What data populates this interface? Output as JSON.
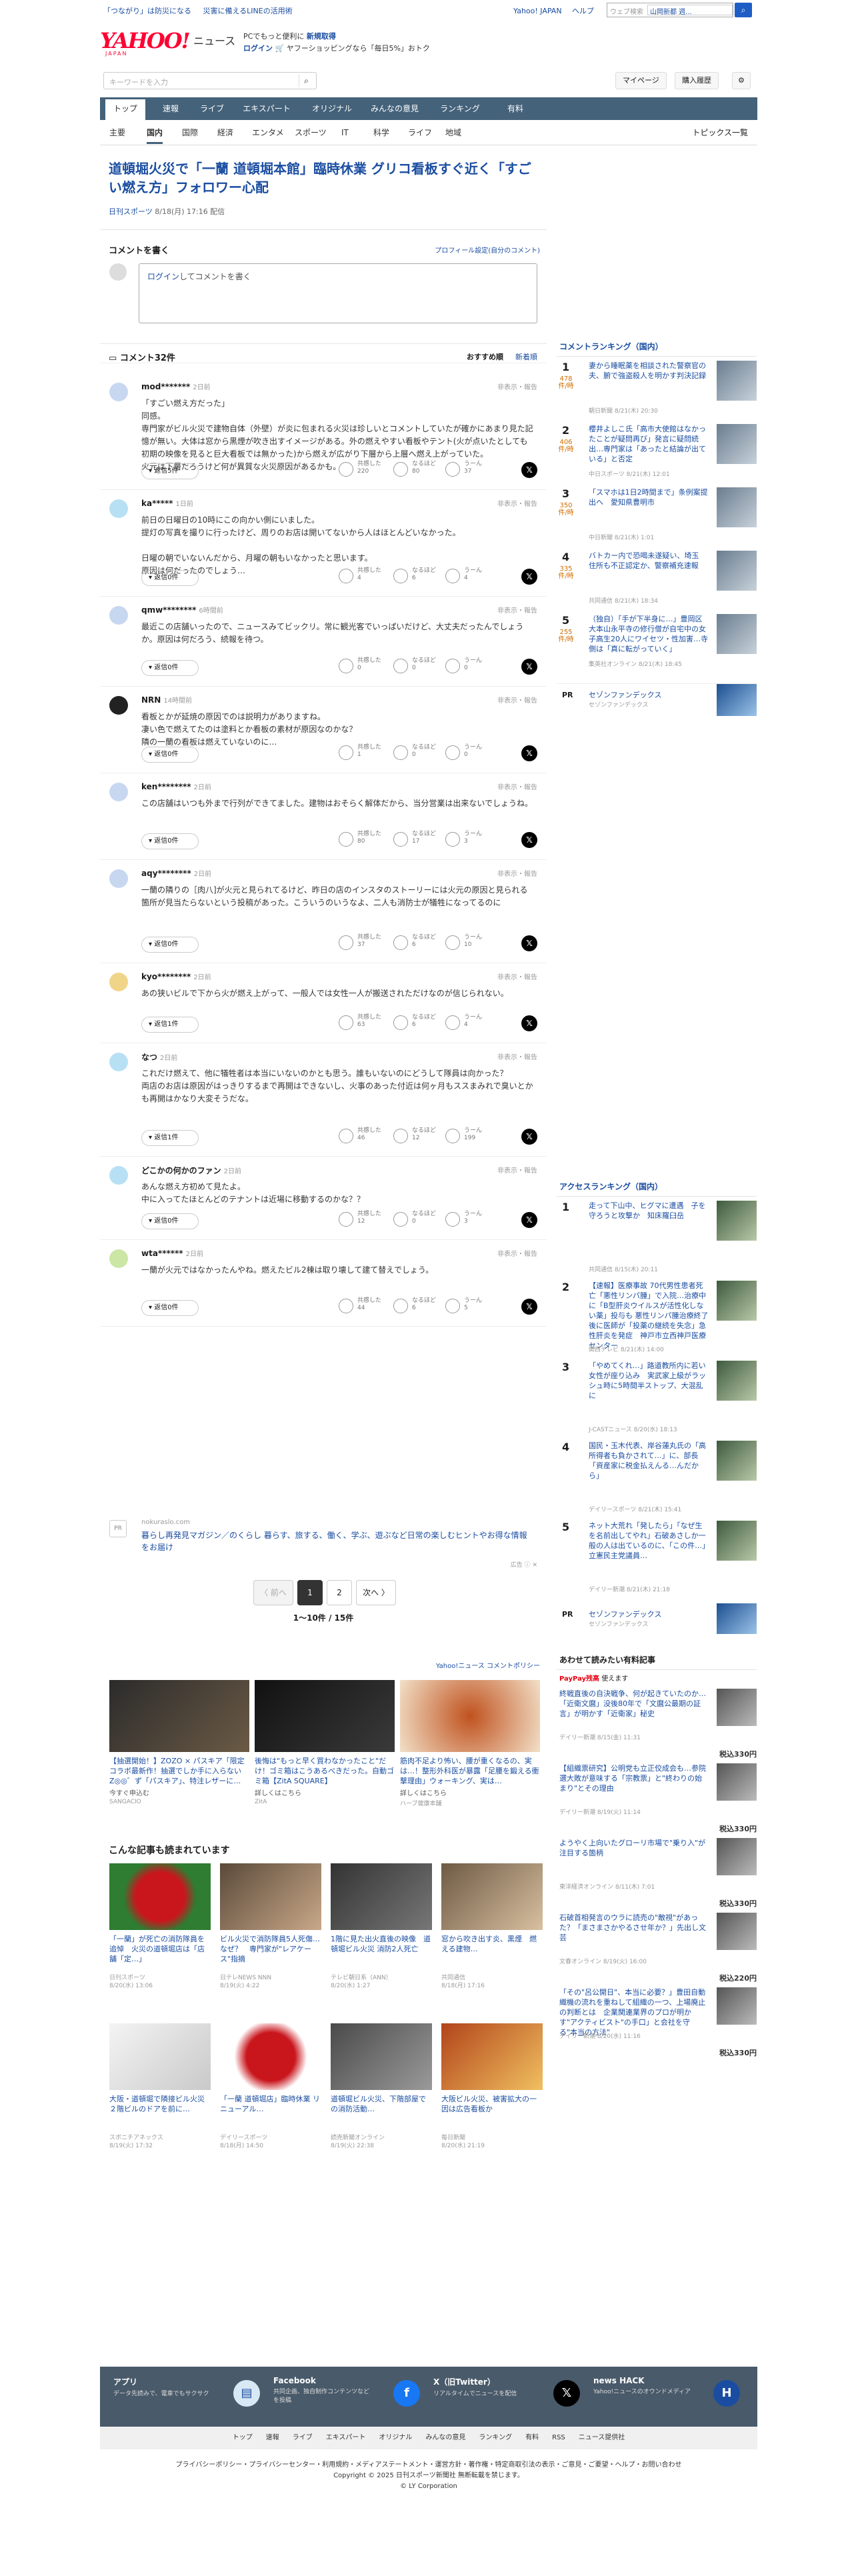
{
  "topstrip": {
    "links_left": [
      "「つながり」は防災になる",
      "災害に備えるLINEの活用術"
    ],
    "links_right": [
      "Yahoo! JAPAN",
      "ヘルプ"
    ],
    "search_placeholder": "ウェブ検索",
    "search_select": "山岡新都 週..."
  },
  "header": {
    "logo_text": "YAHOO!",
    "logo_sub": "JAPAN",
    "brand": "ニュース",
    "promo_line1": "PCでもっと便利に",
    "promo_line1_link": "新規取得",
    "promo_line2_link": "ログイン",
    "promo_line2": "🛒 ヤフーショッピングなら「毎日5%」おトク"
  },
  "search": {
    "placeholder": "キーワードを入力",
    "mypage": "マイページ",
    "history": "購入履歴"
  },
  "nav": {
    "primary": [
      "トップ",
      "速報",
      "ライブ",
      "エキスパート",
      "オリジナル",
      "みんなの意見",
      "ランキング",
      "有料"
    ],
    "primary_active": 0,
    "secondary": [
      "主要",
      "国内",
      "国際",
      "経済",
      "エンタメ",
      "スポーツ",
      "IT",
      "科学",
      "ライフ",
      "地域"
    ],
    "secondary_active": 1,
    "topics": "トピックス一覧"
  },
  "article": {
    "title": "道頓堀火災で「一蘭 道頓堀本館」臨時休業 グリコ看板すぐ近く「すごい燃え方」フォロワー心配",
    "source": "日刊スポーツ",
    "date": "8/18(月) 17:16 配信"
  },
  "comment_form": {
    "heading": "コメントを書く",
    "profile_link": "プロフィール設定(自分のコメント)",
    "login": "ログイン",
    "placeholder": "してコメントを書く"
  },
  "comment_list": {
    "count": "コメント32件",
    "sort_recommended": "おすすめ順",
    "sort_new": "新着順"
  },
  "comments": [
    {
      "user": "mod*******",
      "time": "2日前",
      "report": "非表示・報告",
      "body": "「すごい燃え方だった」\n同感。\n専門家がビル火災で建物自体（外壁）が炎に包まれる火災は珍しいとコメントしていたが確かにあまり見た記憶が無い。大体は窓から黒煙が吹き出すイメージがある。外の燃えやすい看板やテント(火が点いたとしても初期の映像を見ると巨大看板では無かった)から燃えが広がり下層から上層へ燃え上がっていた。\n火元は下層だろうけど何が異質な火災原因があるかも。",
      "reply": "返信5件",
      "r1": "220",
      "r2": "80",
      "r3": "37"
    },
    {
      "user": "ka*****",
      "time": "1日前",
      "report": "非表示・報告",
      "body": "前日の日曜日の10時にこの向かい側にいました。\n提灯の写真を撮りに行ったけど、周りのお店は開いてないから人はほとんどいなかった。\n\n日曜の朝でいないんだから、月曜の朝もいなかったと思います。\n原因は何だったのでしょう…",
      "reply": "返信0件",
      "r1": "4",
      "r2": "6",
      "r3": "4"
    },
    {
      "user": "qmw********",
      "time": "6時間前",
      "report": "非表示・報告",
      "body": "最近この店舗いったので、ニュースみてビックリ。常に観光客でいっぱいだけど、大丈夫だったんでしょうか。原因は何だろう、続報を待つ。",
      "reply": "返信0件",
      "r1": "0",
      "r2": "0",
      "r3": "0"
    },
    {
      "user": "NRN",
      "time": "14時間前",
      "report": "非表示・報告",
      "body": "看板とかが延焼の原因でのは説明力がありますね。\n凄い色で燃えてたのは塗料とか看板の素材が原因なのかな？\n隣の一蘭の看板は燃えていないのに…",
      "reply": "返信0件",
      "r1": "1",
      "r2": "0",
      "r3": "0"
    },
    {
      "user": "ken********",
      "time": "2日前",
      "report": "非表示・報告",
      "body": "この店舗はいつも外まで行列ができてました。建物はおそらく解体だから、当分営業は出来ないでしょうね。",
      "reply": "返信0件",
      "r1": "80",
      "r2": "17",
      "r3": "3"
    },
    {
      "user": "aqy********",
      "time": "2日前",
      "report": "非表示・報告",
      "body": "一蘭の隣りの［肉八]が火元と見られてるけど、昨日の店のインスタのストーリーには火元の原因と見られる箇所が見当たらないという投稿があった。こういうのいうなよ、二人も消防士が犠牲になってるのに",
      "reply": "返信0件",
      "r1": "37",
      "r2": "6",
      "r3": "10"
    },
    {
      "user": "kyo********",
      "time": "2日前",
      "report": "非表示・報告",
      "body": "あの狭いビルで下から火が燃え上がって、一般人では女性一人が搬送されただけなのが信じられない。",
      "reply": "返信1件",
      "r1": "63",
      "r2": "6",
      "r3": "4"
    },
    {
      "user": "なつ",
      "time": "2日前",
      "report": "非表示・報告",
      "body": "これだけ燃えて、他に犠牲者は本当にいないのかとも思う。誰もいないのにどうして隊員は向かった？\n両店のお店は原因がはっきりするまで再開はできないし、火事のあった付近は何ヶ月もススまみれで臭いとかも再開はかなり大変そうだな。",
      "reply": "返信1件",
      "r1": "46",
      "r2": "12",
      "r3": "199"
    },
    {
      "user": "どこかの何かのファン",
      "time": "2日前",
      "report": "非表示・報告",
      "body": "あんな燃え方初めて見たよ。\n中に入ってたほとんどのテナントは近場に移動するのかな？？",
      "reply": "返信0件",
      "r1": "12",
      "r2": "0",
      "r3": "3"
    },
    {
      "user": "wta******",
      "time": "2日前",
      "report": "非表示・報告",
      "body": "一蘭が火元ではなかったんやね。燃えたビル2棟は取り壊して建て替えでしょう。",
      "reply": "返信0件",
      "r1": "44",
      "r2": "6",
      "r3": "5"
    }
  ],
  "reaction_labels": {
    "r1": "共感した",
    "r2": "なるほど",
    "r3": "うーん"
  },
  "ad_text": {
    "domain": "nokuraslo.com",
    "title": "暮らし再発見マガジン／のくらし 暮らす、旅する、働く、学ぶ、遊ぶなど日常の楽しむヒントやお得な情報をお届け",
    "label": "広告"
  },
  "pager": {
    "prev": "〈 前へ",
    "p1": "1",
    "p2": "2",
    "next": "次へ 〉",
    "count": "1〜10件 / 15件"
  },
  "policy_link": "Yahoo!ニュース コメントポリシー",
  "ad_cards": [
    {
      "title": "【抽選開始！】ZOZO × パスキア「限定コラボ最新作！抽選でしか手に入らない Z◎◎゛ず「パスキア」、特注レザーに…",
      "cta": "今すぐ申込む",
      "src": "SANGACIO"
    },
    {
      "title": "後悔は\"もっと早く買わなかったこと\"だけ！ゴミ箱はこうあるべきだった。自動ゴミ箱【ZitA SQUARE】",
      "cta": "詳しくはこちら",
      "src": "ZitA"
    },
    {
      "title": "筋肉不足より怖い、腰が重くなるの、実は…！整形外科医が暴露「足腰を鍛える衝撃理由」ウォーキング、実は…",
      "cta": "詳しくはこちら",
      "src": "ハーブ健康本舗"
    }
  ],
  "reads": {
    "heading": "こんな記事も読まれています",
    "items": [
      {
        "title": "「一蘭」が死亡の消防隊員を追悼　火災の道頓堀店は「店舗「定…」",
        "src": "日刊スポーツ",
        "date": "8/20(水) 13:06"
      },
      {
        "title": "ビル火災で消防隊員5人死傷…なぜ？　専門家が\"レアケース\"指摘",
        "src": "日テレNEWS NNN",
        "date": "8/19(火) 4:22"
      },
      {
        "title": "1階に見た出火直後の映像　道頓堀ビル火災 消防2人死亡",
        "src": "テレビ朝日系（ANN）",
        "date": "8/20(水) 1:27"
      },
      {
        "title": "窓から吹き出す炎、黒煙　燃える建物…",
        "src": "共同通信",
        "date": "8/18(月) 17:16"
      },
      {
        "title": "大阪・道頓堀で隣接ビル火災 ２階ビルのドアを前に…",
        "src": "スポニチアネックス",
        "date": "8/19(火) 17:32"
      },
      {
        "title": "「一蘭 道頓堀店」臨時休業 リニューアル…",
        "src": "デイリースポーツ",
        "date": "8/18(月) 14:50"
      },
      {
        "title": "道頓堀ビル火災、下階部屋での消防活動…",
        "src": "読売新聞オンライン",
        "date": "8/19(火) 22:38"
      },
      {
        "title": "大阪ビル火災、被害拡大の一因は広告看板か",
        "src": "毎日新聞",
        "date": "8/20(水) 21:19"
      }
    ]
  },
  "side_comment_ranking": {
    "heading": "コメントランキング（国内）",
    "items": [
      {
        "rank": "1",
        "count": "478",
        "unit": "件/時",
        "title": "妻から睡眠薬を相談された警察官の夫、腑で強盗殺人を明かす判決記録",
        "meta": "朝日新聞 8/21(木) 20:30"
      },
      {
        "rank": "2",
        "count": "406",
        "unit": "件/時",
        "title": "櫻井よしこ氏「高市大使館はなかったことが疑問再び」発言に疑問続出…専門家は「あったと結論が出ている」と否定",
        "meta": "中日スポーツ 8/21(木) 12:01"
      },
      {
        "rank": "3",
        "count": "350",
        "unit": "件/時",
        "title": "「スマホは1日2時間まで」条例案提出へ　愛知県豊明市",
        "meta": "中日新聞 8/21(木) 1:01"
      },
      {
        "rank": "4",
        "count": "335",
        "unit": "件/時",
        "title": "バトカー内で恐喝未遂疑い、埼玉　住所も不正認定か、警察補充速報",
        "meta": "共同通信 8/21(木) 18:34"
      },
      {
        "rank": "5",
        "count": "255",
        "unit": "件/時",
        "title": "（独自）「手が下半身に…」豊岡区大本山永平寺の修行僧が自宅中の女子高生20人にワイセツ・性加害…寺側は「真に転がっていく」",
        "meta": "集英社オンライン 8/21(木) 18:45"
      }
    ],
    "pr_title": "セゾンファンデックス",
    "pr_sub": "セゾンファンデックス"
  },
  "side_access_ranking": {
    "heading": "アクセスランキング（国内）",
    "items": [
      {
        "rank": "1",
        "title": "走って下山中、ヒグマに遭遇　子を守ろうと攻撃か　知床羅臼岳",
        "meta": "共同通信 8/15(木) 20:11"
      },
      {
        "rank": "2",
        "title": "【速報】医療事故 70代男性患者死亡「悪性リンパ腫」で入院…治療中に「B型肝炎ウイルスが活性化しない薬」投与も 悪性リンパ腫治療終了後に医師が「投薬の継続を失念」急性肝炎を発症　神戸市立西神戸医療センター",
        "meta": "関西テレビ 8/21(木) 14:00"
      },
      {
        "rank": "3",
        "title": "「やめてくれ…」路道教所内に若い女性が座り込み　実武家上級がラッシュ時に5時間半ストップ、大混乱に",
        "meta": "J-CASTニュース 8/20(水) 18:13"
      },
      {
        "rank": "4",
        "title": "国民・玉木代表、岸谷蓮丸氏の「高所得者も負かされて…」に、部長「資産家に税金払えんる…んだから」",
        "meta": "デイリースポーツ 8/21(木) 15:41"
      },
      {
        "rank": "5",
        "title": "ネット大荒れ「発したら」「なぜ生を名前出してやれ」石破あさしか一般の人は出ているのに、「この件…」立憲民主党議員…",
        "meta": "デイリー新潮 8/21(木) 21:18"
      }
    ],
    "pr_title": "セゾンファンデックス",
    "pr_sub": "セゾンファンデックス"
  },
  "side_paid": {
    "heading": "あわせて読みたい有料記事",
    "paypay": "PayPay残高",
    "paypay_note": "使えます",
    "items": [
      {
        "title": "終戦直後の自決戦争、何が起きていたのか…「近衛文麿」没後80年で「文麿公最期の証言」が明かす「近衛家」秘史",
        "meta": "デイリー新潮 8/15(金) 11:31",
        "price": "税込330円"
      },
      {
        "title": "【組織票研究】公明党も立正佼成会も…参院選大敗が意味する「宗教票」と\"終わりの始まり\"とその理由",
        "meta": "デイリー新潮 8/19(火) 11:14",
        "price": "税込330円"
      },
      {
        "title": "ようやく上向いたグローリ市場で\"乗り入\"が注目する箇柄",
        "meta": "東洋経済オンライン 8/11(木) 7:01",
        "price": "税込330円"
      },
      {
        "title": "石破首相発言のウラに読売の\"敵視\"があった？「まさまさかやるさせ年か？」先出し文芸",
        "meta": "文春オンライン 8/19(火) 16:00",
        "price": "税込220円"
      },
      {
        "title": "「その\"呂公開日\"、本当に必要？」豊田自動織機の流れを重ねして組織の一つ、上場廃止の判断とは　企業関連業界のプロが明かす\"アクティビスト\"の手口」と会社を守る\"本当の方法\"",
        "meta": "デイリー新潮 8/20(水) 11:16",
        "price": "税込330円"
      }
    ]
  },
  "footer": {
    "apps": [
      {
        "title": "アプリ",
        "desc": "データ先読みで、電車でもサクサク"
      },
      {
        "title": "Facebook",
        "desc": "共同企画、独自制作コンテンツなどを投稿"
      },
      {
        "title": "X（旧Twitter）",
        "desc": "リアルタイムでニュースを配信"
      },
      {
        "title": "news HACK",
        "desc": "Yahoo!ニュースのオウンドメディア"
      }
    ],
    "nav": [
      "トップ",
      "速報",
      "ライブ",
      "エキスパート",
      "オリジナル",
      "みんなの意見",
      "ランキング",
      "有料",
      "RSS",
      "ニュース提供社"
    ],
    "links1": "プライバシーポリシー・プライバシーセンター・利用規約・メディアステートメント・運営方針・著作権・特定商取引法の表示・ご意見・ご要望・ヘルプ・お問い合わせ",
    "copyright": "Copyright © 2025 日刊スポーツ新聞社 無断転載を禁じます。",
    "copyright2": "© LY Corporation"
  },
  "colors": {
    "accent": "#1a4da1",
    "nav_bg": "#44627a",
    "brand_red": "#ff0033",
    "footer_bg": "#495a6a"
  }
}
